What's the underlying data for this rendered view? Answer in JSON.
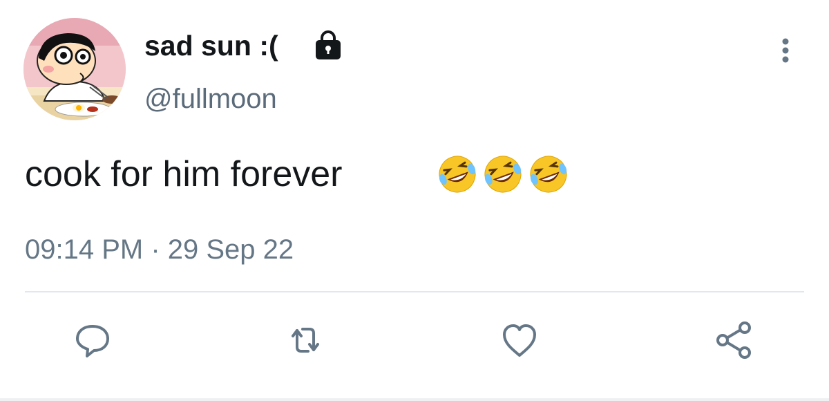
{
  "user": {
    "display_name": "sad sun :(",
    "handle": "@fullmoon",
    "avatar_icon": "cartoon-boy-avatar",
    "protected_icon": "lock-icon"
  },
  "tweet": {
    "text": "cook for him forever",
    "emojis": [
      "rolling-on-floor-laughing",
      "rolling-on-floor-laughing",
      "rolling-on-floor-laughing"
    ],
    "timestamp": "09:14 PM · 29 Sep 22"
  },
  "actions": [
    {
      "name": "reply",
      "icon": "speech-bubble-icon"
    },
    {
      "name": "retweet",
      "icon": "retweet-arrows-icon"
    },
    {
      "name": "like",
      "icon": "heart-icon"
    },
    {
      "name": "share",
      "icon": "share-nodes-icon"
    }
  ],
  "menu_icon": "more-vertical-icon",
  "colors": {
    "text": "#14171a",
    "secondary": "#657786",
    "icon": "#657786",
    "divider": "#e1e8ed"
  }
}
